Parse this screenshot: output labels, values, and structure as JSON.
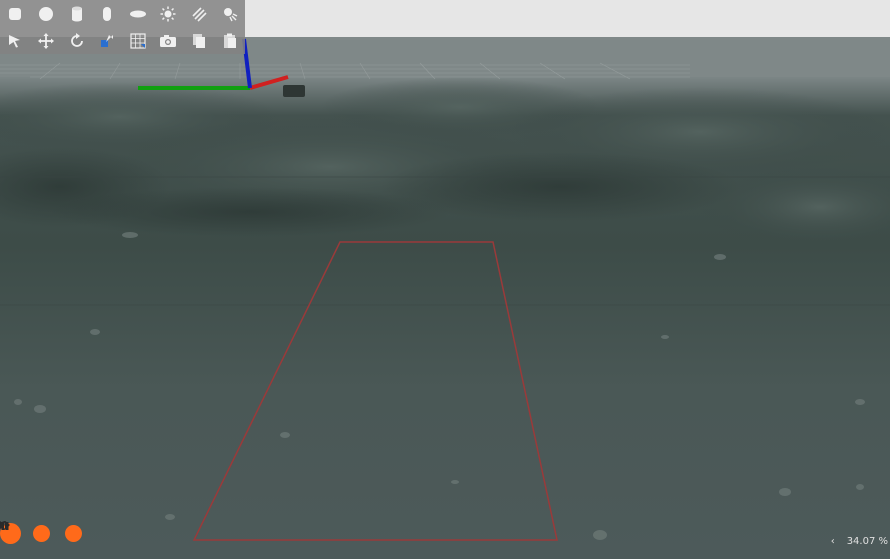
{
  "toolbar": {
    "row1": [
      {
        "name": "box-shape-icon"
      },
      {
        "name": "sphere-shape-icon"
      },
      {
        "name": "cylinder-shape-icon"
      },
      {
        "name": "capsule-shape-icon"
      },
      {
        "name": "ellipsoid-shape-icon"
      },
      {
        "name": "point-light-icon"
      },
      {
        "name": "directional-light-icon"
      },
      {
        "name": "spot-light-icon"
      }
    ],
    "row2": [
      {
        "name": "select-mode-icon"
      },
      {
        "name": "translate-mode-icon"
      },
      {
        "name": "rotate-mode-icon"
      },
      {
        "name": "scale-mode-icon"
      },
      {
        "name": "align-icon"
      },
      {
        "name": "screenshot-icon"
      },
      {
        "name": "copy-icon"
      },
      {
        "name": "paste-icon"
      }
    ]
  },
  "controls": {
    "pause_icon": "pause-icon",
    "step_icon": "fast-forward-icon",
    "reset_icon": "reset-icon"
  },
  "status": {
    "real_time_factor": "34.07 %",
    "collapse_icon": "chevron-left-icon"
  },
  "colors": {
    "accent": "#ff6a1a",
    "sky": "#e6e6e6",
    "axis_x": "#d02020",
    "axis_y": "#10a010",
    "axis_z": "#1020c0",
    "selection_box": "#9a3a3a"
  }
}
